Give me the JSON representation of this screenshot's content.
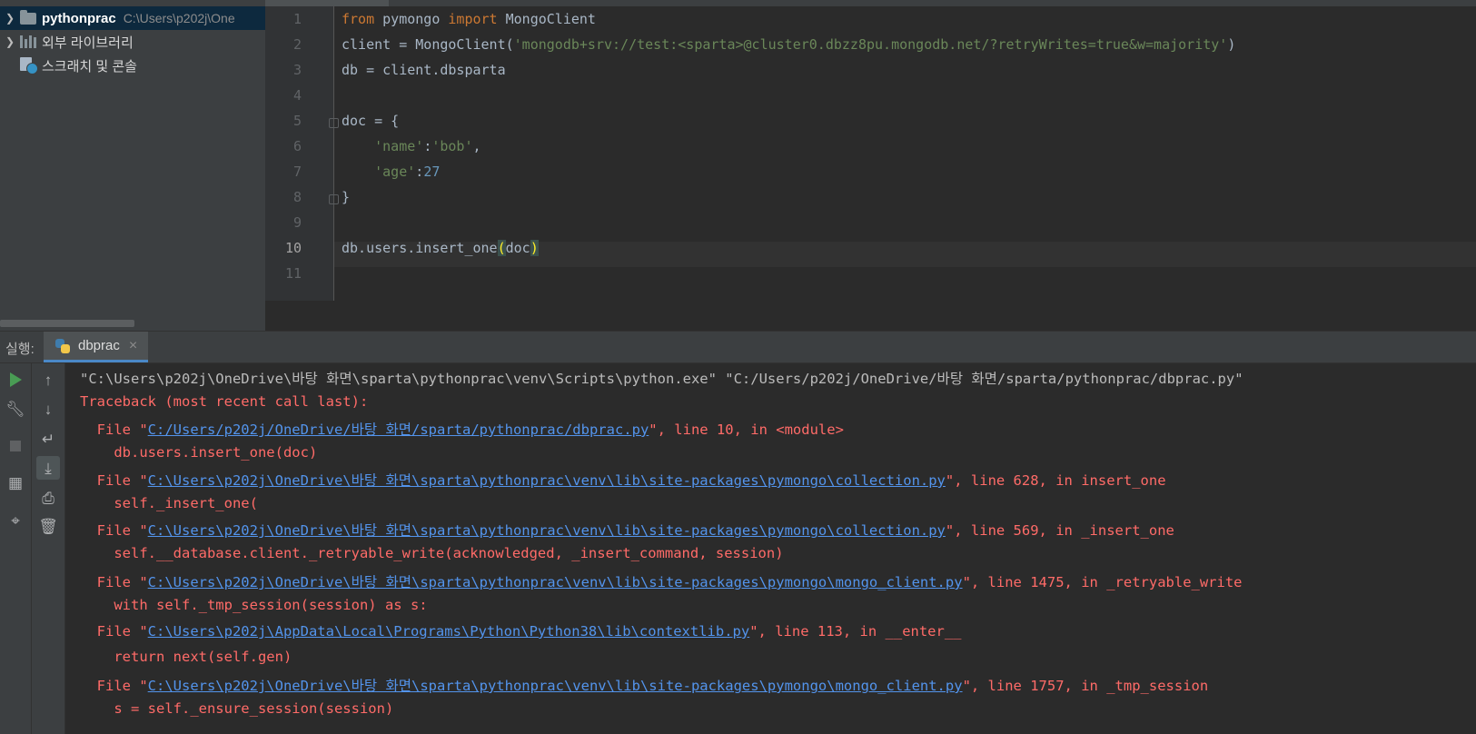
{
  "project_tree": {
    "items": [
      {
        "name": "pythonprac",
        "path": "C:\\Users\\p202j\\One"
      },
      {
        "name": "외부 라이브러리"
      },
      {
        "name": "스크래치 및 콘솔"
      }
    ]
  },
  "editor": {
    "line_numbers": [
      "1",
      "2",
      "3",
      "4",
      "5",
      "6",
      "7",
      "8",
      "9",
      "10",
      "11"
    ],
    "code": {
      "l1_kw1": "from",
      "l1_mod": " pymongo ",
      "l1_kw2": "import",
      "l1_cls": " MongoClient",
      "l2_pre": "client = MongoClient(",
      "l2_str": "'mongodb+srv://test:<sparta>@cluster0.dbzz8pu.mongodb.net/?retryWrites=true&w=majority'",
      "l2_post": ")",
      "l3": "db = client.dbsparta",
      "l5": "doc = {",
      "l6_key": "'name'",
      "l6_colon": ":",
      "l6_val": "'bob'",
      "l6_comma": ",",
      "l7_key": "'age'",
      "l7_colon": ":",
      "l7_val": "27",
      "l8": "}",
      "l10_pre": "db.users.insert_one",
      "l10_open": "(",
      "l10_arg": "doc",
      "l10_close": ")"
    }
  },
  "run_panel": {
    "label": "실행:",
    "tab": "dbprac",
    "close": "×",
    "console": {
      "command": "\"C:\\Users\\p202j\\OneDrive\\바탕 화면\\sparta\\pythonprac\\venv\\Scripts\\python.exe\" \"C:/Users/p202j/OneDrive/바탕 화면/sparta/pythonprac/dbprac.py\"",
      "traceback_header": "Traceback (most recent call last):",
      "frames": [
        {
          "pre": "  File \"",
          "link": "C:/Users/p202j/OneDrive/바탕 화면/sparta/pythonprac/dbprac.py",
          "post": "\", line 10, in <module>",
          "code": "    db.users.insert_one(doc)"
        },
        {
          "pre": "  File \"",
          "link": "C:\\Users\\p202j\\OneDrive\\바탕 화면\\sparta\\pythonprac\\venv\\lib\\site-packages\\pymongo\\collection.py",
          "post": "\", line 628, in insert_one",
          "code": "    self._insert_one("
        },
        {
          "pre": "  File \"",
          "link": "C:\\Users\\p202j\\OneDrive\\바탕 화면\\sparta\\pythonprac\\venv\\lib\\site-packages\\pymongo\\collection.py",
          "post": "\", line 569, in _insert_one",
          "code": "    self.__database.client._retryable_write(acknowledged, _insert_command, session)"
        },
        {
          "pre": "  File \"",
          "link": "C:\\Users\\p202j\\OneDrive\\바탕 화면\\sparta\\pythonprac\\venv\\lib\\site-packages\\pymongo\\mongo_client.py",
          "post": "\", line 1475, in _retryable_write",
          "code": "    with self._tmp_session(session) as s:"
        },
        {
          "pre": "  File \"",
          "link": "C:\\Users\\p202j\\AppData\\Local\\Programs\\Python\\Python38\\lib\\contextlib.py",
          "post": "\", line 113, in __enter__",
          "code": "    return next(self.gen)"
        },
        {
          "pre": "  File \"",
          "link": "C:\\Users\\p202j\\OneDrive\\바탕 화면\\sparta\\pythonprac\\venv\\lib\\site-packages\\pymongo\\mongo_client.py",
          "post": "\", line 1757, in _tmp_session",
          "code": "    s = self._ensure_session(session)"
        }
      ]
    }
  },
  "icons": {
    "toolbar_left": [
      "run-icon",
      "wrench-icon",
      "stop-icon",
      "layout-icon",
      "pin-icon"
    ],
    "toolbar_right": [
      "arrow-up-icon",
      "arrow-down-icon",
      "soft-wrap-icon",
      "scroll-to-end-icon",
      "print-icon",
      "trash-icon"
    ]
  },
  "colors": {
    "keyword": "#cc7832",
    "string": "#6a8759",
    "number": "#6897bb",
    "error": "#ff6b68",
    "link": "#5394ec",
    "run_green": "#499c54"
  }
}
